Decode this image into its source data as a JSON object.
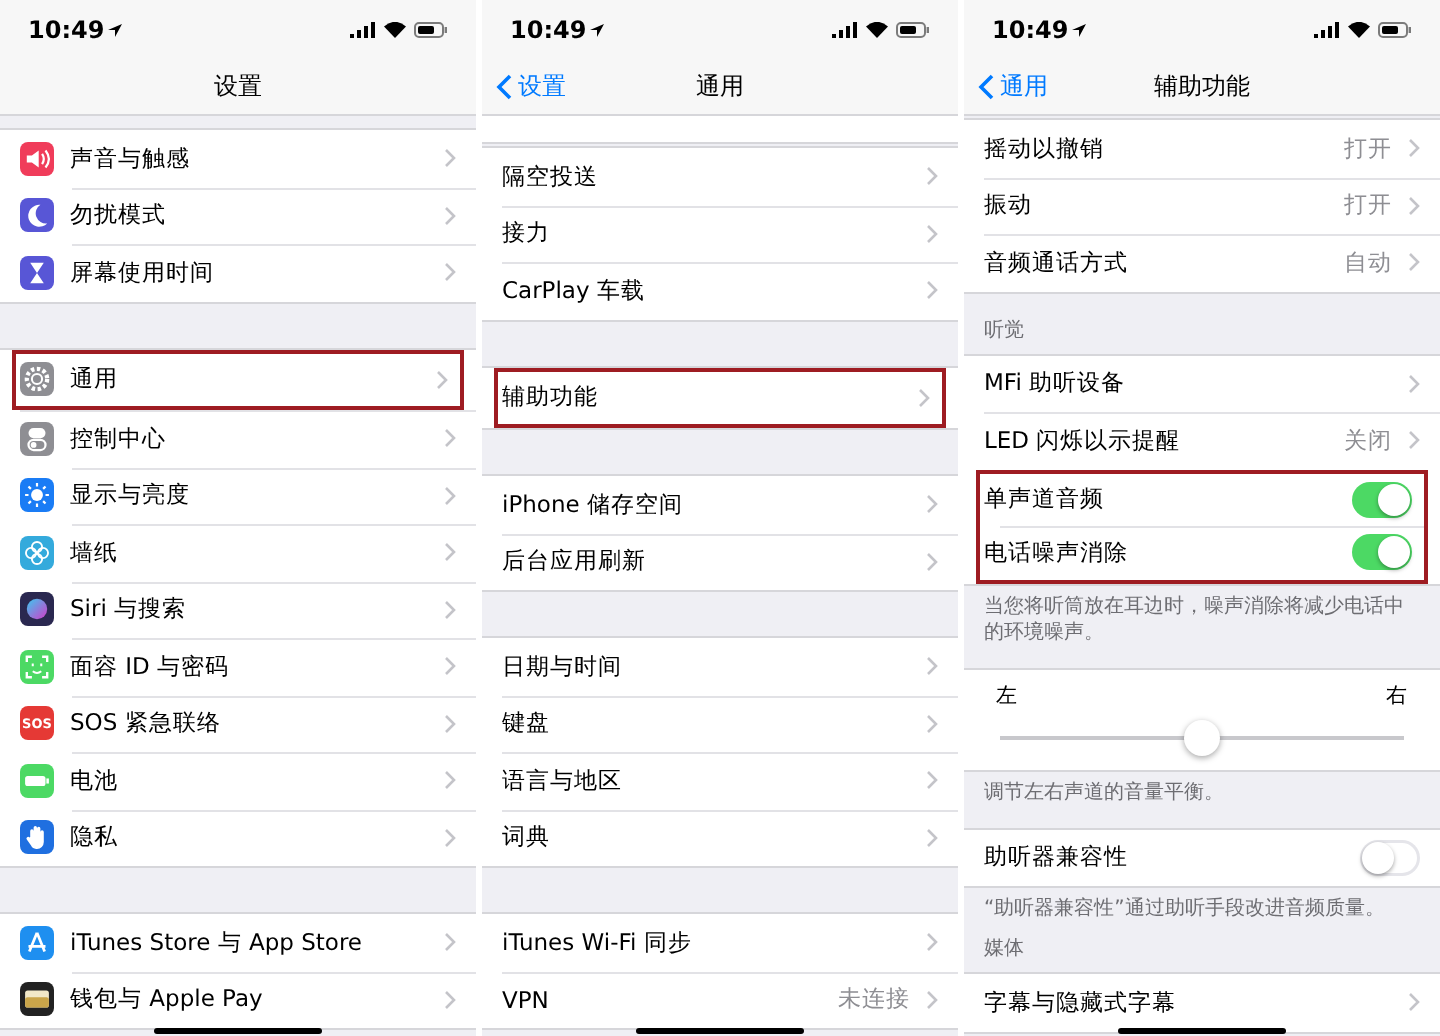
{
  "panels": [
    {
      "status": {
        "time": "10:49"
      },
      "nav": {
        "title": "设置"
      },
      "groups": [
        {
          "rows": [
            {
              "kind": "icon",
              "label": "声音与触感",
              "color": "#f03c5a",
              "highlighted": false
            },
            {
              "kind": "icon",
              "label": "勿扰模式",
              "color": "#5856d6",
              "highlighted": false
            },
            {
              "kind": "icon",
              "label": "屏幕使用时间",
              "color": "#5856d6",
              "highlighted": false
            }
          ]
        },
        {
          "rows": [
            {
              "kind": "icon",
              "label": "通用",
              "color": "#8e8e93",
              "highlighted": true
            },
            {
              "kind": "icon",
              "label": "控制中心",
              "color": "#8e8e93",
              "highlighted": false
            },
            {
              "kind": "icon",
              "label": "显示与亮度",
              "color": "#1a7cf5",
              "highlighted": false
            },
            {
              "kind": "icon",
              "label": "墙纸",
              "color": "#34aadc",
              "highlighted": false
            },
            {
              "kind": "icon",
              "label": "Siri 与搜索",
              "color": "#2a2850",
              "highlighted": false
            },
            {
              "kind": "icon",
              "label": "面容 ID 与密码",
              "color": "#4cd964",
              "highlighted": false
            },
            {
              "kind": "icon",
              "label": "SOS 紧急联络",
              "color": "#e53935",
              "icon_text": "SOS",
              "highlighted": false
            },
            {
              "kind": "icon",
              "label": "电池",
              "color": "#4cd964",
              "highlighted": false
            },
            {
              "kind": "icon",
              "label": "隐私",
              "color": "#1f6fe0",
              "highlighted": false
            }
          ]
        },
        {
          "rows": [
            {
              "kind": "icon",
              "label": "iTunes Store 与 App Store",
              "color": "#1e8ff0",
              "highlighted": false
            },
            {
              "kind": "icon",
              "label": "钱包与 Apple Pay",
              "color": "#222222",
              "highlighted": false
            }
          ]
        }
      ]
    },
    {
      "status": {
        "time": "10:49"
      },
      "nav": {
        "back": "设置",
        "title": "通用"
      },
      "clipped_top": true,
      "groups": [
        {
          "rows": [
            {
              "kind": "link",
              "label": "隔空投送",
              "highlighted": false
            },
            {
              "kind": "link",
              "label": "接力",
              "highlighted": false
            },
            {
              "kind": "link",
              "label": "CarPlay 车载",
              "highlighted": false
            }
          ]
        },
        {
          "rows": [
            {
              "kind": "link",
              "label": "辅助功能",
              "highlighted": true
            }
          ]
        },
        {
          "rows": [
            {
              "kind": "link",
              "label": "iPhone 储存空间",
              "highlighted": false
            },
            {
              "kind": "link",
              "label": "后台应用刷新",
              "highlighted": false
            }
          ]
        },
        {
          "rows": [
            {
              "kind": "link",
              "label": "日期与时间",
              "highlighted": false
            },
            {
              "kind": "link",
              "label": "键盘",
              "highlighted": false
            },
            {
              "kind": "link",
              "label": "语言与地区",
              "highlighted": false
            },
            {
              "kind": "link",
              "label": "词典",
              "highlighted": false
            }
          ]
        },
        {
          "rows": [
            {
              "kind": "link",
              "label": "iTunes Wi-Fi 同步",
              "highlighted": false
            },
            {
              "kind": "link",
              "label": "VPN",
              "value": "未连接",
              "highlighted": false
            }
          ]
        }
      ]
    },
    {
      "status": {
        "time": "10:49"
      },
      "nav": {
        "back": "通用",
        "title": "辅助功能"
      },
      "groups": [
        {
          "rows": [
            {
              "kind": "link",
              "label": "摇动以撤销",
              "value": "打开",
              "highlighted": false
            },
            {
              "kind": "link",
              "label": "振动",
              "value": "打开",
              "highlighted": false
            },
            {
              "kind": "link",
              "label": "音频通话方式",
              "value": "自动",
              "highlighted": false
            }
          ]
        },
        {
          "header": "听觉",
          "rows": [
            {
              "kind": "link",
              "label": "MFi 助听设备",
              "highlighted": false
            },
            {
              "kind": "link",
              "label": "LED 闪烁以示提醒",
              "value": "关闭",
              "highlighted": false
            },
            {
              "kind": "toggle",
              "label": "单声道音频",
              "on": true,
              "highlighted": true
            },
            {
              "kind": "toggle",
              "label": "电话噪声消除",
              "on": true,
              "highlighted": true
            }
          ],
          "footer": "当您将听筒放在耳边时，噪声消除将减少电话中的环境噪声。"
        },
        {
          "rows": [
            {
              "kind": "slider",
              "left": "左",
              "right": "右",
              "level": 0.5,
              "highlighted": false
            }
          ],
          "footer": "调节左右声道的音量平衡。"
        },
        {
          "rows": [
            {
              "kind": "toggle",
              "label": "助听器兼容性",
              "on": false,
              "highlighted": false
            }
          ],
          "footer": "“助听器兼容性”通过助听手段改进音频质量。"
        },
        {
          "header": "媒体",
          "rows": [
            {
              "kind": "link",
              "label": "字幕与隐藏式字幕",
              "highlighted": false
            }
          ]
        }
      ]
    }
  ]
}
